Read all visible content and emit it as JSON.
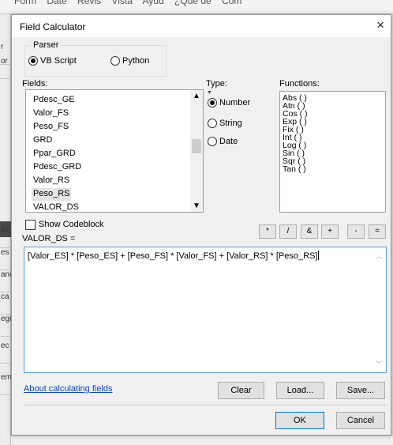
{
  "background": {
    "menu": [
      "Form",
      "Date",
      "Revis",
      "Vista",
      "Ayud",
      "¿Qué de",
      "Com"
    ],
    "side_cells": [
      "r",
      "or",
      "",
      "",
      "",
      "",
      "",
      "",
      "Ar",
      "es",
      "ano",
      "ca",
      "egi",
      "ec",
      "em"
    ]
  },
  "dialog": {
    "title": "Field Calculator",
    "close_glyph": "×",
    "parser": {
      "legend": "Parser",
      "options": [
        "VB Script",
        "Python"
      ],
      "selected": "VB Script"
    },
    "fields": {
      "label": "Fields:",
      "items": [
        "Pdesc_GE",
        "Valor_FS",
        "Peso_FS",
        "GRD",
        "Ppar_GRD",
        "Pdesc_GRD",
        "Valor_RS",
        "Peso_RS",
        "VALOR_DS"
      ],
      "selected": "Peso_RS"
    },
    "type": {
      "label": "Type:",
      "options": [
        "Number",
        "String",
        "Date"
      ],
      "selected": "Number"
    },
    "functions": {
      "label": "Functions:",
      "items": [
        "Abs ( )",
        "Atn ( )",
        "Cos ( )",
        "Exp ( )",
        "Fix ( )",
        "Int ( )",
        "Log ( )",
        "Sin ( )",
        "Sqr ( )",
        "Tan ( )"
      ]
    },
    "show_codeblock": {
      "label": "Show Codeblock",
      "checked": false
    },
    "operators": [
      "*",
      "/",
      "&",
      "+",
      "-",
      "="
    ],
    "target_label": "VALOR_DS =",
    "expression": "[Valor_ES] * [Peso_ES] + [Peso_FS] * [Valor_FS] + [Valor_RS] * [Peso_RS]",
    "help_link": "About calculating fields",
    "buttons": {
      "clear": "Clear",
      "load": "Load...",
      "save": "Save...",
      "ok": "OK",
      "cancel": "Cancel"
    }
  },
  "colors": {
    "link": "#0b45c8",
    "focus_border": "#5b9bd5",
    "default_button_border": "#0078d7"
  }
}
